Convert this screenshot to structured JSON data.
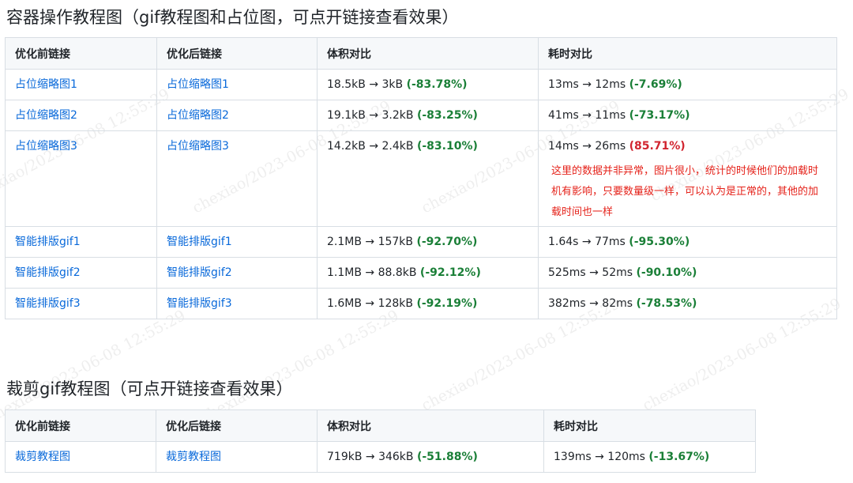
{
  "section1": {
    "title": "容器操作教程图（gif教程图和占位图，可点开链接查看效果）",
    "headers": [
      "优化前链接",
      "优化后链接",
      "体积对比",
      "耗时对比"
    ],
    "rows": [
      {
        "before": "占位缩略图1",
        "after": "占位缩略图1",
        "size": "18.5kB → 3kB ",
        "size_pct": "(-83.78%)",
        "time": "13ms → 12ms ",
        "time_pct": "(-7.69%)"
      },
      {
        "before": "占位缩略图2",
        "after": "占位缩略图2",
        "size": "19.1kB → 3.2kB ",
        "size_pct": "(-83.25%)",
        "time": "41ms → 11ms ",
        "time_pct": "(-73.17%)"
      },
      {
        "before": "占位缩略图3",
        "after": "占位缩略图3",
        "size": "14.2kB → 2.4kB ",
        "size_pct": "(-83.10%)",
        "time": "14ms → 26ms ",
        "time_pct": "(85.71%)",
        "note": "这里的数据并非异常，图片很小，统计的时候他们的加载时机有影响，只要数量级一样，可以认为是正常的，其他的加载时间也一样"
      },
      {
        "before": "智能排版gif1",
        "after": "智能排版gif1",
        "size": "2.1MB → 157kB ",
        "size_pct": "(-92.70%)",
        "time": "1.64s → 77ms ",
        "time_pct": "(-95.30%)"
      },
      {
        "before": "智能排版gif2",
        "after": "智能排版gif2",
        "size": "1.1MB → 88.8kB ",
        "size_pct": "(-92.12%)",
        "time": "525ms → 52ms ",
        "time_pct": "(-90.10%)"
      },
      {
        "before": "智能排版gif3",
        "after": "智能排版gif3",
        "size": "1.6MB → 128kB ",
        "size_pct": "(-92.19%)",
        "time": "382ms → 82ms ",
        "time_pct": "(-78.53%)"
      }
    ]
  },
  "section2": {
    "title": "裁剪gif教程图（可点开链接查看效果）",
    "headers": [
      "优化前链接",
      "优化后链接",
      "体积对比",
      "耗时对比"
    ],
    "rows": [
      {
        "before": "裁剪教程图",
        "after": "裁剪教程图",
        "size": "719kB → 346kB ",
        "size_pct": "(-51.88%)",
        "time": "139ms → 120ms ",
        "time_pct": "(-13.67%)"
      }
    ]
  },
  "watermark": "chexiao/2023-06-08 12:55:29",
  "colors": {
    "link": "#0969da",
    "good": "#1a7f37",
    "bad": "#d1242f",
    "note": "#e5231b",
    "header_bg": "#f6f8fa",
    "border": "#d8dee4"
  }
}
